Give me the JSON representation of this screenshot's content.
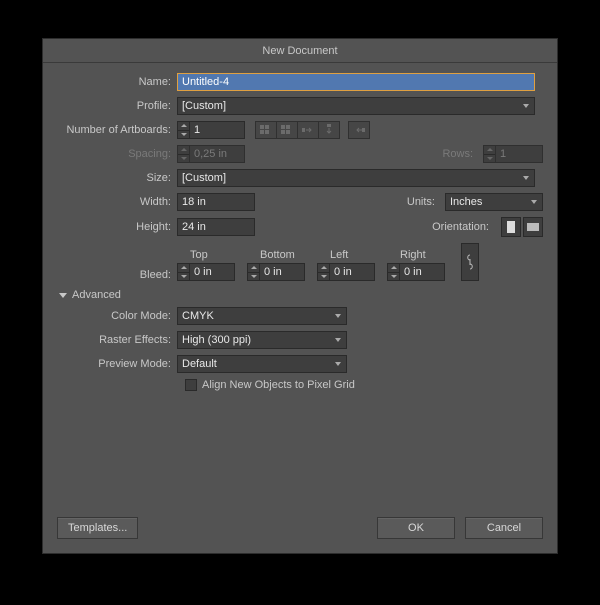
{
  "title": "New Document",
  "labels": {
    "name": "Name:",
    "profile": "Profile:",
    "artboards": "Number of Artboards:",
    "spacing": "Spacing:",
    "rows": "Rows:",
    "size": "Size:",
    "width": "Width:",
    "height": "Height:",
    "units": "Units:",
    "orientation": "Orientation:",
    "bleed": "Bleed:",
    "top": "Top",
    "bottom": "Bottom",
    "left": "Left",
    "right": "Right",
    "advanced": "Advanced",
    "color_mode": "Color Mode:",
    "raster": "Raster Effects:",
    "preview": "Preview Mode:",
    "align_pixel": "Align New Objects to Pixel Grid"
  },
  "values": {
    "name": "Untitled-4",
    "profile": "[Custom]",
    "artboards": "1",
    "spacing": "0,25 in",
    "rows": "1",
    "size": "[Custom]",
    "width": "18 in",
    "height": "24 in",
    "units": "Inches",
    "bleed_top": "0 in",
    "bleed_bottom": "0 in",
    "bleed_left": "0 in",
    "bleed_right": "0 in",
    "color_mode": "CMYK",
    "raster": "High (300 ppi)",
    "preview": "Default"
  },
  "buttons": {
    "templates": "Templates...",
    "ok": "OK",
    "cancel": "Cancel"
  }
}
